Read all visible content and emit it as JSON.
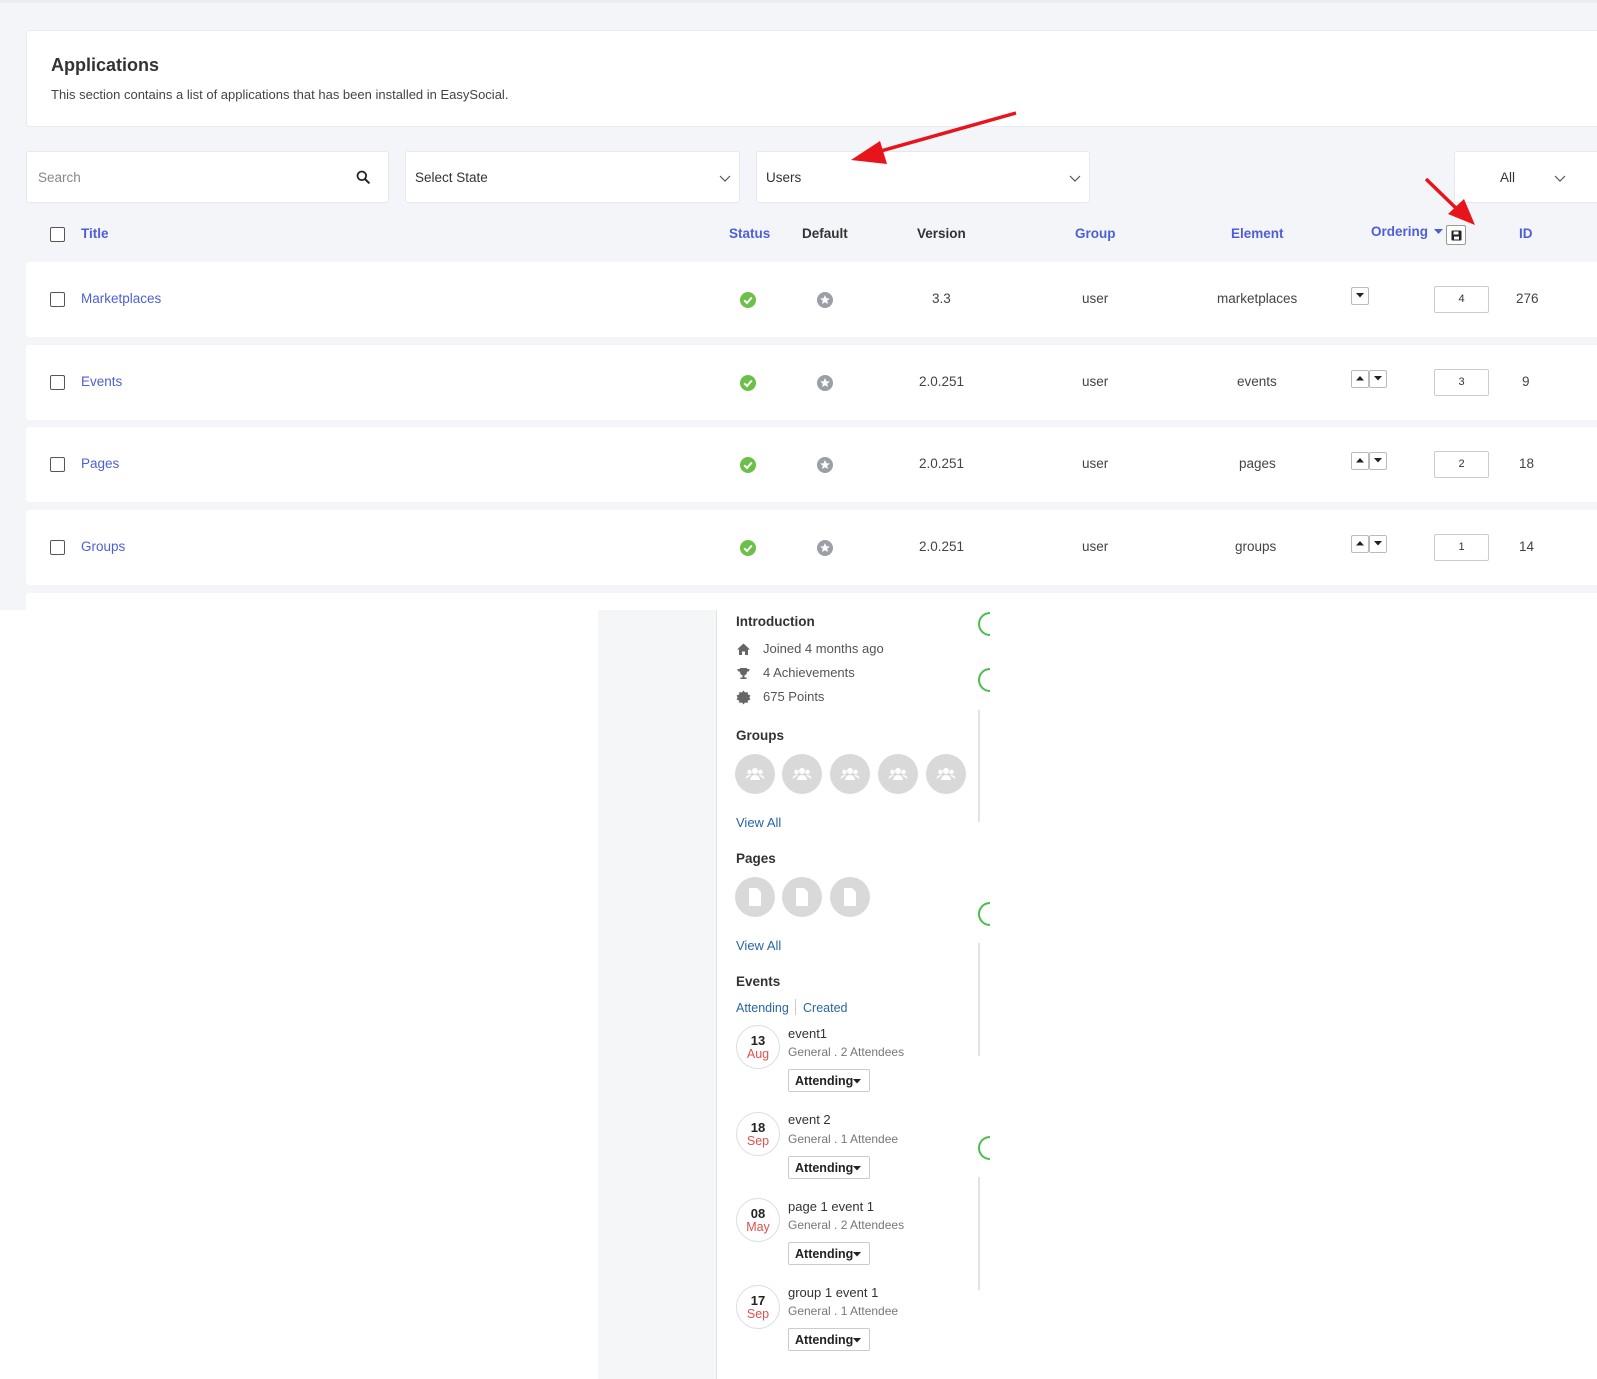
{
  "header": {
    "title": "Applications",
    "description": "This section contains a list of applications that has been installed in EasySocial."
  },
  "filters": {
    "search_placeholder": "Search",
    "state_select": "Select State",
    "group_select": "Users",
    "limit_select": "All"
  },
  "columns": {
    "title": "Title",
    "status": "Status",
    "default": "Default",
    "version": "Version",
    "group": "Group",
    "element": "Element",
    "ordering": "Ordering",
    "id": "ID"
  },
  "rows": [
    {
      "title": "Marketplaces",
      "version": "3.3",
      "group": "user",
      "element": "marketplaces",
      "ordering": "4",
      "id": "276"
    },
    {
      "title": "Events",
      "version": "2.0.251",
      "group": "user",
      "element": "events",
      "ordering": "3",
      "id": "9"
    },
    {
      "title": "Pages",
      "version": "2.0.251",
      "group": "user",
      "element": "pages",
      "ordering": "2",
      "id": "18"
    },
    {
      "title": "Groups",
      "version": "2.0.251",
      "group": "user",
      "element": "groups",
      "ordering": "1",
      "id": "14"
    }
  ],
  "profile": {
    "intro_title": "Introduction",
    "joined": "Joined 4 months ago",
    "achievements": "4 Achievements",
    "points": "675 Points",
    "groups_title": "Groups",
    "groups_view_all": "View All",
    "pages_title": "Pages",
    "pages_view_all": "View All",
    "events_title": "Events",
    "tab_attending": "Attending",
    "tab_created": "Created",
    "events": [
      {
        "day": "13",
        "month": "Aug",
        "name": "event1",
        "meta": "General .  2 Attendees",
        "rsvp": "Attending"
      },
      {
        "day": "18",
        "month": "Sep",
        "name": "event 2",
        "meta": "General .  1 Attendee",
        "rsvp": "Attending"
      },
      {
        "day": "08",
        "month": "May",
        "name": "page 1 event 1",
        "meta": "General .  2 Attendees",
        "rsvp": "Attending"
      },
      {
        "day": "17",
        "month": "Sep",
        "name": "group 1 event 1",
        "meta": "General .  1 Attendee",
        "rsvp": "Attending"
      }
    ]
  },
  "colors": {
    "link": "#4e5fd6",
    "status_ok": "#6cc04a",
    "annotation_arrow": "#e8141b",
    "event_month": "#e0504e"
  }
}
